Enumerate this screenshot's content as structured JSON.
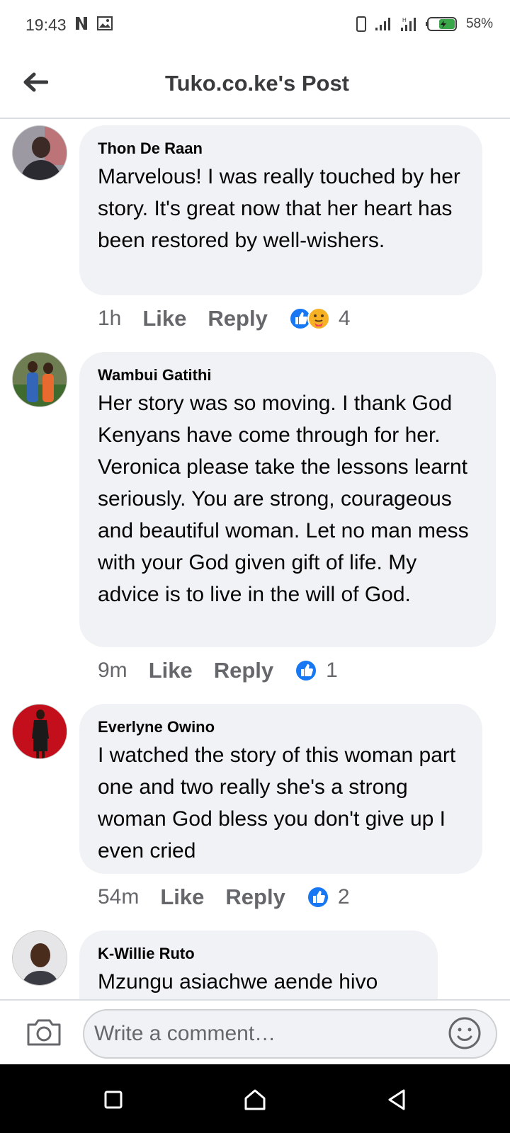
{
  "status_bar": {
    "time": "19:43",
    "battery": "58%"
  },
  "header": {
    "title": "Tuko.co.ke's Post"
  },
  "comments": [
    {
      "author": "Thon De Raan",
      "text": "Marvelous! I was really touched by her story. It's great now that her heart has been restored by well-wishers.",
      "time": "1h",
      "like_label": "Like",
      "reply_label": "Reply",
      "reactions": [
        "like-icon",
        "care-icon"
      ],
      "reaction_count": "4"
    },
    {
      "author": "Wambui Gatithi",
      "text": "Her story was so moving. I thank God Kenyans have come through for her. Veronica please take the lessons learnt seriously. You are strong, courageous and beautiful woman. Let no man mess with your God given gift of life. My advice is to live in the will of God.",
      "time": "9m",
      "like_label": "Like",
      "reply_label": "Reply",
      "reactions": [
        "like-icon"
      ],
      "reaction_count": "1"
    },
    {
      "author": "Everlyne Owino",
      "text": "I watched the story of this woman part one and two really she's a strong woman  God bless you don't give up I even cried",
      "time": "54m",
      "like_label": "Like",
      "reply_label": "Reply",
      "reactions": [
        "like-icon"
      ],
      "reaction_count": "2"
    },
    {
      "author": "K-Willie Ruto",
      "text": "Mzungu asiachwe aende hivo"
    }
  ],
  "composer": {
    "placeholder": "Write a comment…"
  },
  "colors": {
    "bubble": "#f0f2f5",
    "secondary_text": "#65676b",
    "like_blue": "#1877f2",
    "care_yellow": "#f7b125"
  }
}
